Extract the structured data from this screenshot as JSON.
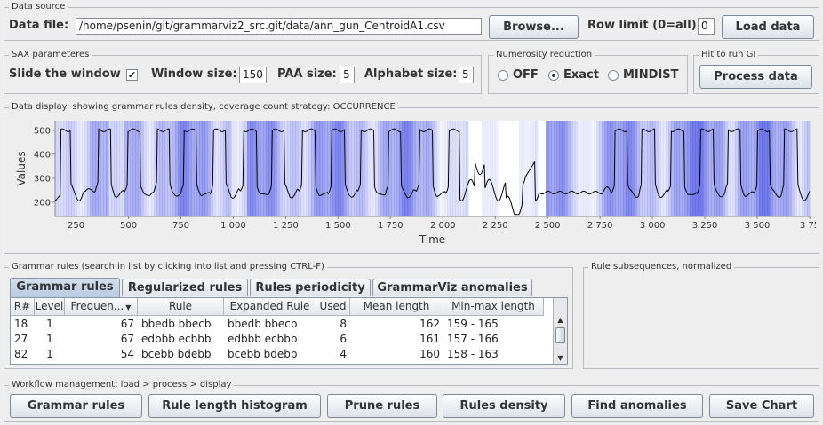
{
  "data_source": {
    "title": "Data source",
    "file_label": "Data file:",
    "file_path": "/home/psenin/git/grammarviz2_src.git/data/ann_gun_CentroidA1.csv",
    "browse_label": "Browse...",
    "row_limit_label": "Row limit (0=all):",
    "row_limit_value": "0",
    "load_label": "Load data"
  },
  "sax": {
    "title": "SAX parameteres",
    "slide_label": "Slide the window",
    "slide_checked": "✔",
    "window_label": "Window size:",
    "window_value": "150",
    "paa_label": "PAA size:",
    "paa_value": "5",
    "alphabet_label": "Alphabet size:",
    "alphabet_value": "5"
  },
  "numerosity": {
    "title": "Numerosity reduction",
    "options": [
      "OFF",
      "Exact",
      "MINDIST"
    ],
    "selected": "Exact"
  },
  "gi": {
    "title": "Hit to run GI",
    "process_label": "Process data"
  },
  "display": {
    "title": "Data display: showing grammar rules density, coverage count strategy: OCCURRENCE"
  },
  "chart_data": {
    "type": "line",
    "xlabel": "Time",
    "ylabel": "Values",
    "xlim": [
      150,
      3750
    ],
    "ylim": [
      140,
      540
    ],
    "x_ticks": [
      "250",
      "500",
      "750",
      "1 000",
      "1 250",
      "1 500",
      "1 750",
      "2 000",
      "2 250",
      "2 500",
      "2 750",
      "3 000",
      "3 250",
      "3 500",
      "3 75"
    ],
    "y_ticks": [
      "500",
      "400",
      "300",
      "200"
    ],
    "series_color": "#000000",
    "background": "grammar rule density heatmap (blue = high coverage, white = low)",
    "density_color": "#5a63e6",
    "peak_times": [
      195,
      385,
      525,
      665,
      795,
      935,
      1080,
      1215,
      1360,
      1500,
      1640,
      1770,
      1920,
      2060,
      2850,
      2980,
      3120,
      3260,
      3390,
      3530,
      3660
    ],
    "peak_height": 500,
    "baseline": 240,
    "low_density_intervals": [
      [
        2110,
        2180
      ],
      [
        2260,
        2360
      ],
      [
        2440,
        2480
      ]
    ]
  },
  "grammar": {
    "title": "Grammar rules (search in list by clicking into list and pressing CTRL-F)",
    "tabs": [
      "Grammar rules",
      "Regularized rules",
      "Rules periodicity",
      "GrammarViz anomalies"
    ],
    "columns": [
      "R#",
      "Level",
      "Frequen...",
      "Rule",
      "Expanded Rule",
      "Used",
      "Mean length",
      "Min-max length"
    ],
    "rows": [
      [
        "18",
        "1",
        "67",
        "bbedb bbecb",
        "bbedb bbecb",
        "8",
        "162",
        "159 - 165"
      ],
      [
        "27",
        "1",
        "67",
        "edbbb ecbbb",
        "edbbb ecbbb",
        "6",
        "161",
        "157 - 166"
      ],
      [
        "82",
        "1",
        "54",
        "bcebb bdebb",
        "bcebb bdebb",
        "4",
        "160",
        "158 - 163"
      ]
    ]
  },
  "subsequences": {
    "title": "Rule subsequences, normalized"
  },
  "workflow": {
    "title": "Workflow management: load > process > display",
    "buttons": [
      "Grammar rules",
      "Rule length histogram",
      "Prune rules",
      "Rules density",
      "Find anomalies",
      "Save Chart"
    ]
  }
}
